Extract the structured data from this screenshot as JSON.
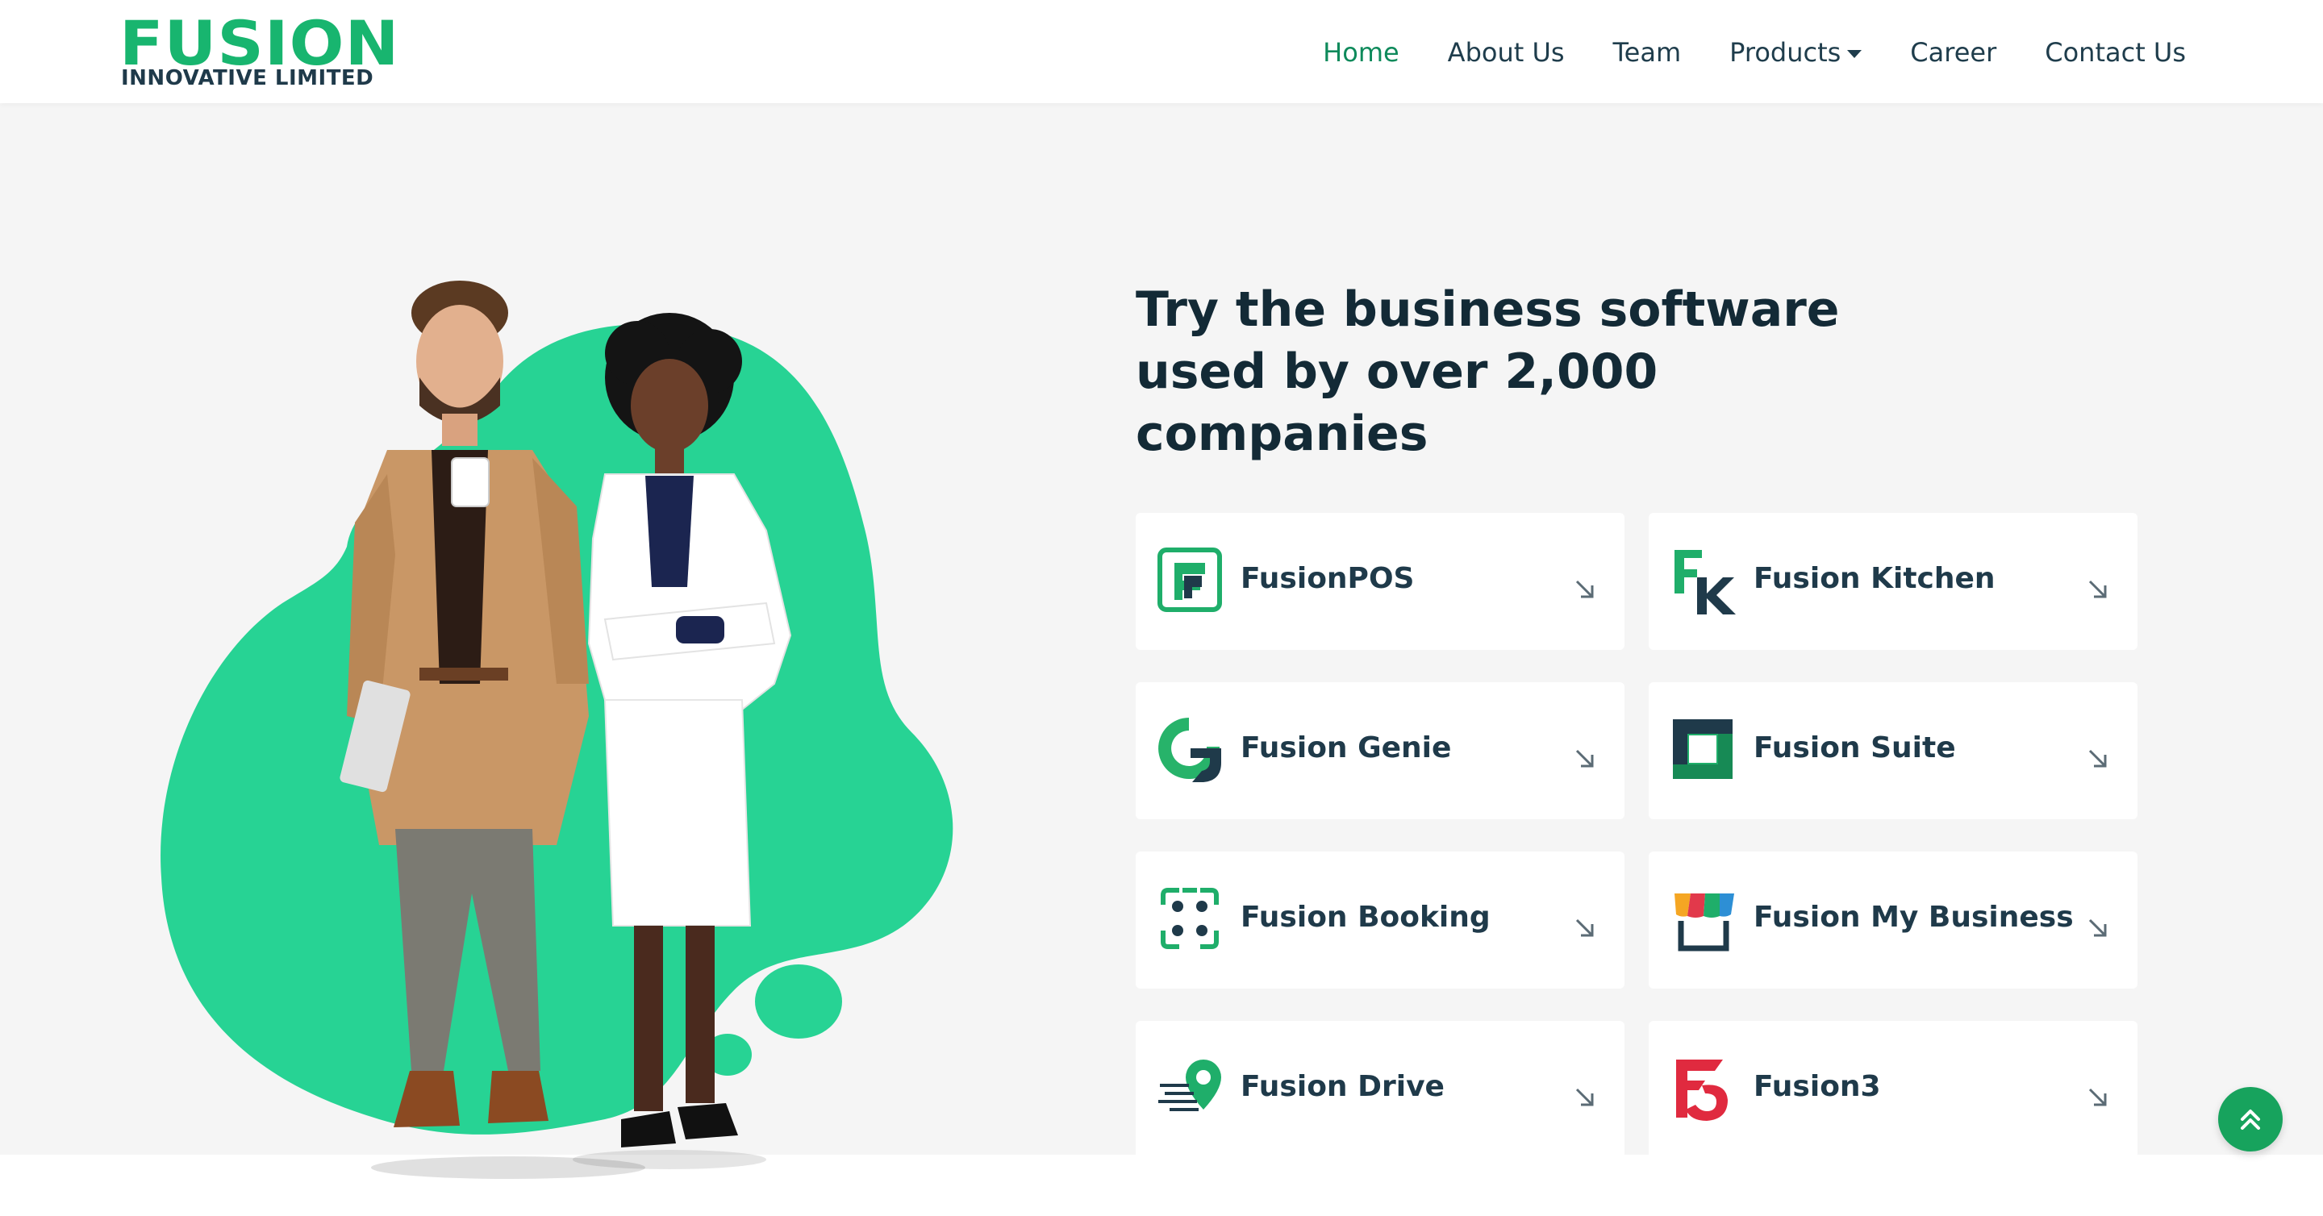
{
  "brand": {
    "name": "FUSION",
    "tagline": "INNOVATIVE LIMITED"
  },
  "nav": {
    "items": [
      {
        "label": "Home",
        "active": true
      },
      {
        "label": "About Us"
      },
      {
        "label": "Team"
      },
      {
        "label": "Products",
        "has_dropdown": true
      },
      {
        "label": "Career"
      },
      {
        "label": "Contact Us"
      }
    ]
  },
  "hero": {
    "headline": "Try the business software used by over 2,000 companies"
  },
  "products": [
    {
      "label": "FusionPOS",
      "icon": "fusionpos-icon"
    },
    {
      "label": "Fusion Kitchen",
      "icon": "fusion-kitchen-icon"
    },
    {
      "label": "Fusion Genie",
      "icon": "fusion-genie-icon"
    },
    {
      "label": "Fusion Suite",
      "icon": "fusion-suite-icon"
    },
    {
      "label": "Fusion Booking",
      "icon": "fusion-booking-icon"
    },
    {
      "label": "Fusion My Business",
      "icon": "fusion-my-business-icon"
    },
    {
      "label": "Fusion Drive",
      "icon": "fusion-drive-icon"
    },
    {
      "label": "Fusion3",
      "icon": "fusion3-icon"
    }
  ],
  "colors": {
    "brand_green": "#18b56f",
    "blob_green": "#27d394",
    "dark_text": "#132a36",
    "nav_active": "#0e8a5b",
    "hero_bg": "#f5f5f5",
    "scroll_button": "#17a35d"
  },
  "scroll_top": {
    "icon": "double-chevron-up-icon"
  }
}
